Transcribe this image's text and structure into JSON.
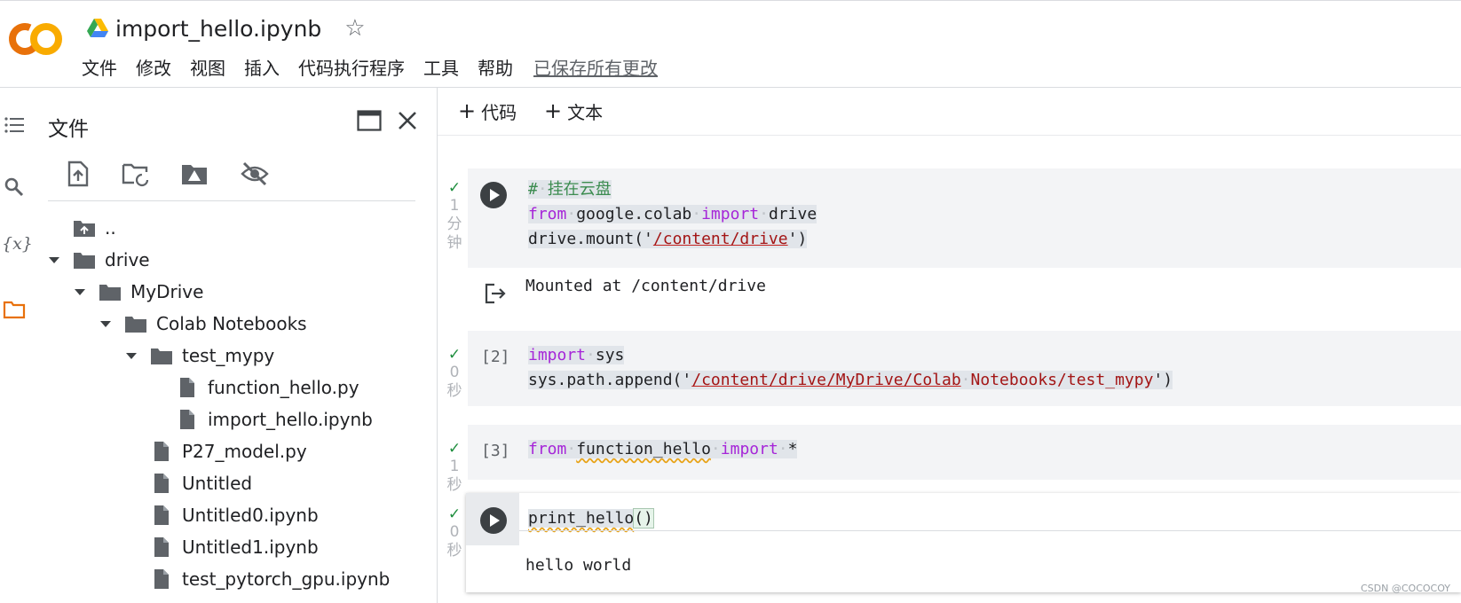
{
  "app": {
    "title": "import_hello.ipynb",
    "colors": {
      "logo_orange": "#F9AB00",
      "logo_dark": "#E8710A",
      "accent_check": "#1e8e3e",
      "keyword": "#a626d8",
      "comment": "#3c8c50",
      "string": "#a31515"
    }
  },
  "menubar": {
    "items": [
      "文件",
      "修改",
      "视图",
      "插入",
      "代码执行程序",
      "工具",
      "帮助"
    ],
    "saved_label": "已保存所有更改"
  },
  "left_rail": {
    "icons": [
      "toc-icon",
      "search-icon",
      "variables-icon",
      "folder-icon"
    ],
    "variables_label": "{x}"
  },
  "sidebar": {
    "title": "文件",
    "toolbar_icons": [
      "upload-file-icon",
      "refresh-folder-icon",
      "mount-drive-icon",
      "hide-hidden-files-icon"
    ],
    "tree": [
      {
        "label": "..",
        "type": "parent-folder",
        "indent": 0,
        "caret": "none"
      },
      {
        "label": "drive",
        "type": "folder",
        "indent": 0,
        "caret": "open"
      },
      {
        "label": "MyDrive",
        "type": "folder",
        "indent": 1,
        "caret": "open"
      },
      {
        "label": "Colab Notebooks",
        "type": "folder",
        "indent": 2,
        "caret": "open"
      },
      {
        "label": "test_mypy",
        "type": "folder",
        "indent": 3,
        "caret": "open"
      },
      {
        "label": "function_hello.py",
        "type": "file",
        "indent": 4,
        "caret": "none"
      },
      {
        "label": "import_hello.ipynb",
        "type": "file",
        "indent": 4,
        "caret": "none"
      },
      {
        "label": "P27_model.py",
        "type": "file",
        "indent": 3,
        "caret": "none"
      },
      {
        "label": "Untitled",
        "type": "file",
        "indent": 3,
        "caret": "none"
      },
      {
        "label": "Untitled0.ipynb",
        "type": "file",
        "indent": 3,
        "caret": "none"
      },
      {
        "label": "Untitled1.ipynb",
        "type": "file",
        "indent": 3,
        "caret": "none"
      },
      {
        "label": "test_pytorch_gpu.ipynb",
        "type": "file",
        "indent": 3,
        "caret": "none"
      }
    ]
  },
  "notebook_toolbar": {
    "add_code": "代码",
    "add_text": "文本",
    "plus": "+"
  },
  "cells": [
    {
      "status": [
        "1",
        "分",
        "钟"
      ],
      "exec": "run-button",
      "lines": [
        [
          {
            "t": "#",
            "c": "cm"
          },
          {
            "t": "·",
            "c": "dot"
          },
          {
            "t": "挂在云盘",
            "c": "cm"
          }
        ],
        [
          {
            "t": "from",
            "c": "kw"
          },
          {
            "t": "·",
            "c": "dot"
          },
          {
            "t": "google.colab",
            "c": ""
          },
          {
            "t": "·",
            "c": "dot"
          },
          {
            "t": "import",
            "c": "kw"
          },
          {
            "t": "·",
            "c": "dot"
          },
          {
            "t": "drive",
            "c": ""
          }
        ],
        [
          {
            "t": "drive.mount('",
            "c": ""
          },
          {
            "t": "/content/drive",
            "c": "str"
          },
          {
            "t": "')",
            "c": ""
          }
        ]
      ],
      "output": "Mounted at /content/drive"
    },
    {
      "status": [
        "0",
        "秒"
      ],
      "exec": "[2]",
      "lines": [
        [
          {
            "t": "import",
            "c": "kw"
          },
          {
            "t": "·",
            "c": "dot"
          },
          {
            "t": "sys",
            "c": ""
          }
        ],
        [
          {
            "t": "sys.path.append('",
            "c": ""
          },
          {
            "t": "/content/drive/MyDrive/Colab",
            "c": "str"
          },
          {
            "t": "·",
            "c": "dot"
          },
          {
            "t": "Notebooks/test_mypy",
            "c": "strp"
          },
          {
            "t": "')",
            "c": ""
          }
        ]
      ]
    },
    {
      "status": [
        "1",
        "秒"
      ],
      "exec": "[3]",
      "lines": [
        [
          {
            "t": "from",
            "c": "kw"
          },
          {
            "t": "·",
            "c": "dot"
          },
          {
            "t": "function_hello",
            "c": "sq"
          },
          {
            "t": "·",
            "c": "dot"
          },
          {
            "t": "import",
            "c": "kw"
          },
          {
            "t": "·",
            "c": "dot"
          },
          {
            "t": "*",
            "c": ""
          }
        ]
      ]
    },
    {
      "status": [
        "0",
        "秒"
      ],
      "exec": "run-button",
      "lines": [
        [
          {
            "t": "print_hello",
            "c": "sq"
          },
          {
            "t": "()",
            "c": "br"
          }
        ]
      ],
      "output": "hello world"
    }
  ],
  "watermark": "CSDN @COCOCOY"
}
